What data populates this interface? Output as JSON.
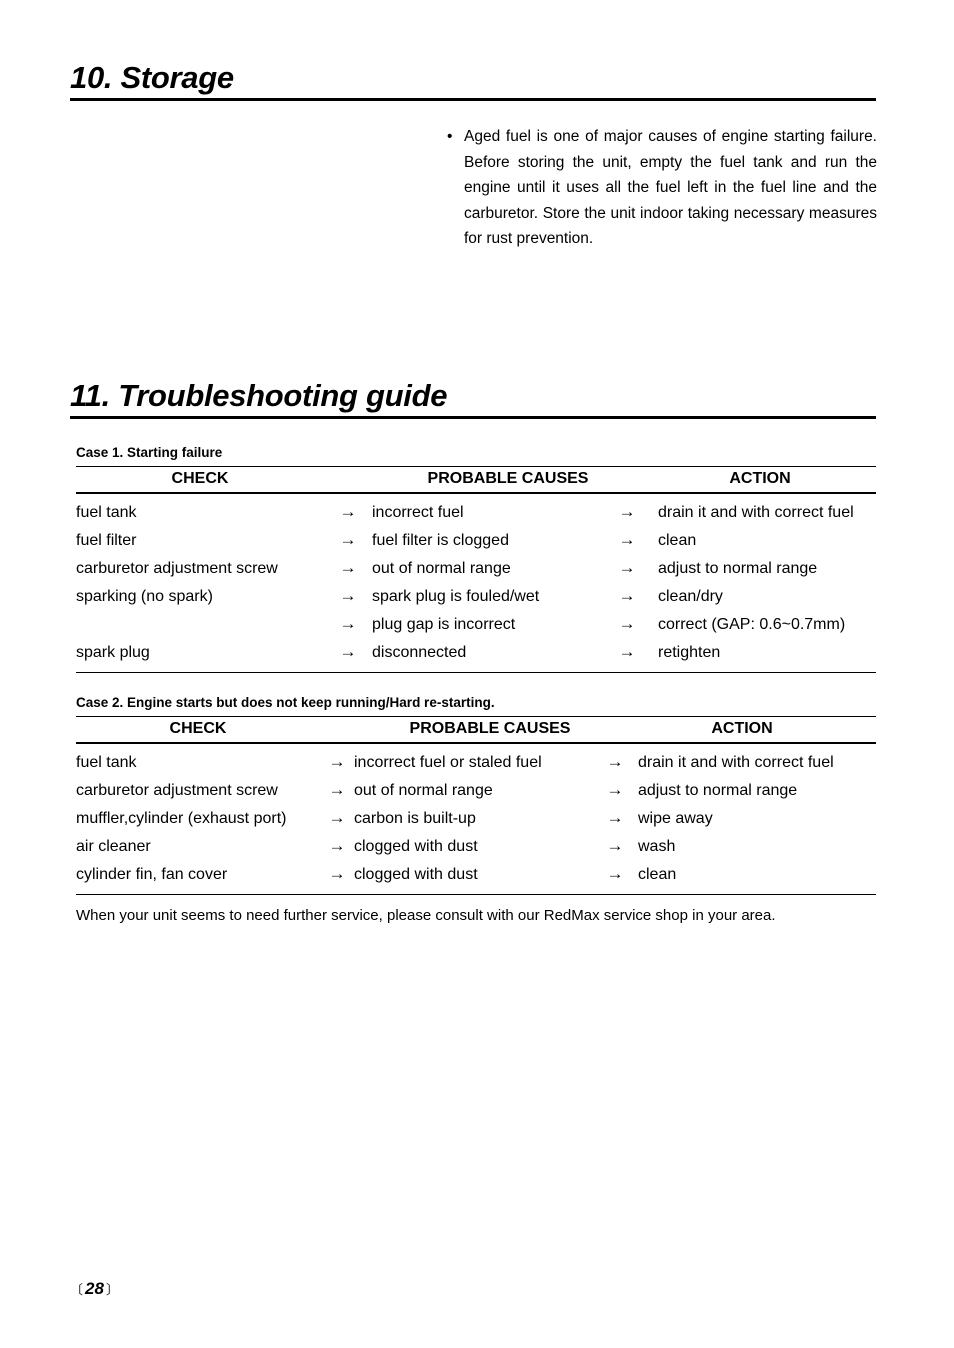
{
  "document": {
    "page_number": "28",
    "page_number_bracket_left": "〔",
    "page_number_bracket_right": "〕"
  },
  "sections": {
    "storage": {
      "heading": "10. Storage",
      "bullet_marker": "•",
      "bullet_text": "Aged fuel is one of major causes of engine starting failure. Before storing the unit, empty the fuel tank and run the engine until it uses all the fuel left in the fuel line and the carburetor. Store the unit indoor taking necessary measures for rust prevention."
    },
    "troubleshooting": {
      "heading": "11. Troubleshooting guide",
      "closing_note": "When your unit seems to need further service, please consult with our RedMax service shop in your area.",
      "columns": {
        "check": "CHECK",
        "probable_causes": "PROBABLE CAUSES",
        "action": "ACTION"
      },
      "arrow_glyph": "→",
      "cases": [
        {
          "caption": "Case 1. Starting failure",
          "rows": [
            {
              "check": "fuel tank",
              "cause": "incorrect fuel",
              "action": "drain it and with correct fuel"
            },
            {
              "check": "fuel filter",
              "cause": "fuel filter is clogged",
              "action": "clean"
            },
            {
              "check": "carburetor adjustment screw",
              "cause": "out of normal range",
              "action": "adjust to normal range"
            },
            {
              "check": "sparking (no spark)",
              "cause": "spark plug is fouled/wet",
              "action": "clean/dry"
            },
            {
              "check": "",
              "cause": "plug gap is incorrect",
              "action": "correct (GAP: 0.6~0.7mm)"
            },
            {
              "check": "spark plug",
              "cause": "disconnected",
              "action": "retighten"
            }
          ]
        },
        {
          "caption": "Case 2. Engine starts but does not keep running/Hard re-starting.",
          "rows": [
            {
              "check": "fuel tank",
              "cause": "incorrect fuel or staled fuel",
              "action": "drain it and with correct fuel"
            },
            {
              "check": "carburetor adjustment screw",
              "cause": "out of normal range",
              "action": "adjust to normal range"
            },
            {
              "check": "muffler,cylinder (exhaust port)",
              "cause": "carbon is built-up",
              "action": "wipe away"
            },
            {
              "check": "air cleaner",
              "cause": "clogged with dust",
              "action": "wash"
            },
            {
              "check": "cylinder fin, fan cover",
              "cause": "clogged with dust",
              "action": "clean"
            }
          ]
        }
      ]
    }
  }
}
